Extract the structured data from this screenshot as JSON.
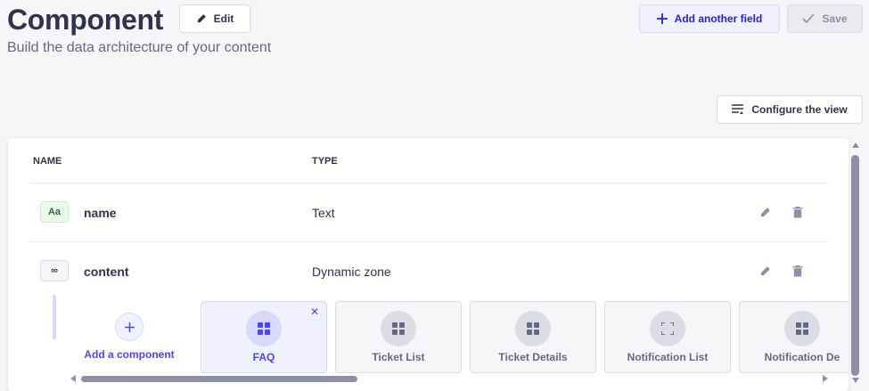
{
  "header": {
    "title": "Component",
    "subtitle": "Build the data architecture of your content",
    "edit_label": "Edit",
    "add_field_label": "Add another field",
    "save_label": "Save",
    "configure_label": "Configure the view"
  },
  "table": {
    "headers": {
      "name": "NAME",
      "type": "TYPE"
    },
    "rows": [
      {
        "badge": "Aa",
        "name": "name",
        "type": "Text"
      },
      {
        "badge": "∞",
        "name": "content",
        "type": "Dynamic zone"
      }
    ]
  },
  "dynamic_zone": {
    "add_label": "Add a component",
    "components": [
      {
        "label": "FAQ",
        "icon": "grid-icon",
        "active": true
      },
      {
        "label": "Ticket List",
        "icon": "grid-icon",
        "active": false
      },
      {
        "label": "Ticket Details",
        "icon": "grid-icon",
        "active": false
      },
      {
        "label": "Notification List",
        "icon": "expand-icon",
        "active": false
      },
      {
        "label": "Notification De",
        "icon": "grid-icon",
        "active": false
      }
    ]
  },
  "colors": {
    "primary": "#4945ff",
    "primary_light": "#f0f0ff",
    "text": "#32324d",
    "muted": "#666687",
    "background": "#f6f6f9"
  }
}
